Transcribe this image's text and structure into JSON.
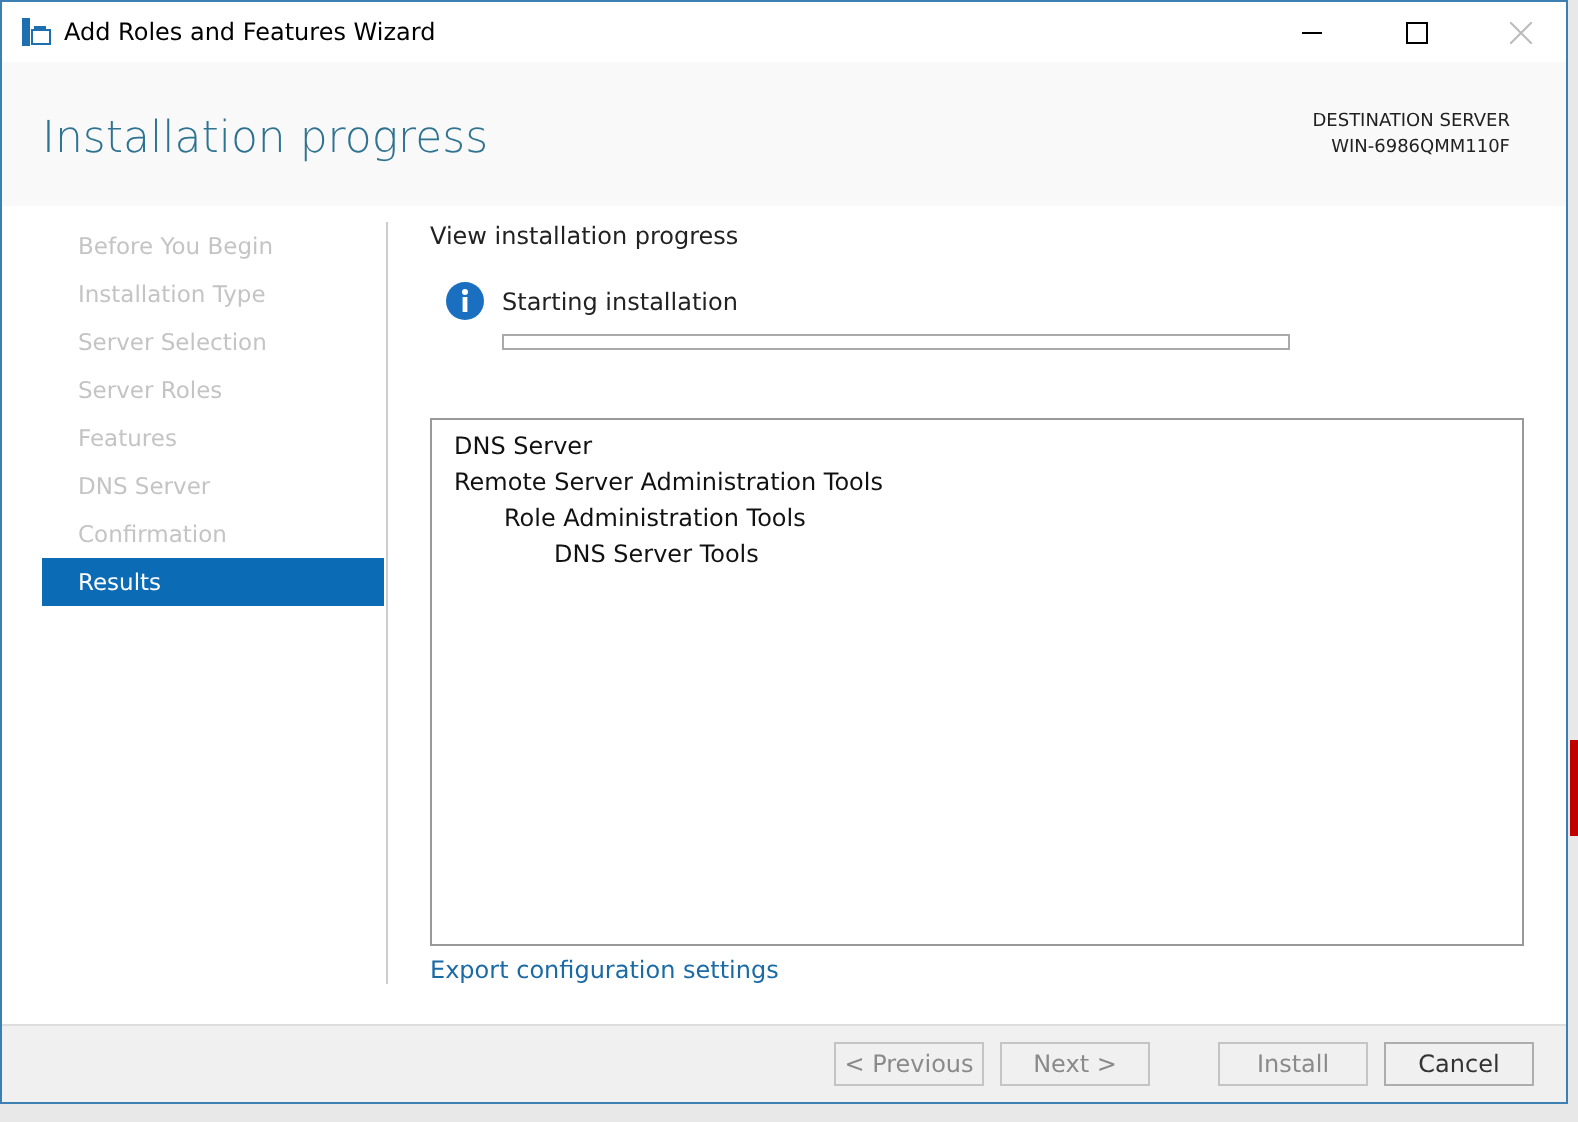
{
  "window": {
    "title": "Add Roles and Features Wizard"
  },
  "header": {
    "title": "Installation progress",
    "destination_label": "DESTINATION SERVER",
    "destination_server": "WIN-6986QMM110F"
  },
  "steps": [
    {
      "label": "Before You Begin",
      "selected": false
    },
    {
      "label": "Installation Type",
      "selected": false
    },
    {
      "label": "Server Selection",
      "selected": false
    },
    {
      "label": "Server Roles",
      "selected": false
    },
    {
      "label": "Features",
      "selected": false
    },
    {
      "label": "DNS Server",
      "selected": false
    },
    {
      "label": "Confirmation",
      "selected": false
    },
    {
      "label": "Results",
      "selected": true
    }
  ],
  "content": {
    "heading": "View installation progress",
    "status": "Starting installation",
    "progress": {
      "level": 0
    },
    "features": [
      {
        "label": "DNS Server"
      },
      {
        "label": "Remote Server Administration Tools",
        "children": [
          {
            "label": "Role Administration Tools",
            "children": [
              {
                "label": "DNS Server Tools"
              }
            ]
          }
        ]
      }
    ],
    "link": "Export configuration settings"
  },
  "buttons": [
    {
      "label": "< Previous",
      "disabled": true
    },
    {
      "label": "Next >",
      "disabled": true
    },
    {
      "label": "Install",
      "disabled": true
    },
    {
      "label": "Cancel",
      "disabled": false
    }
  ]
}
